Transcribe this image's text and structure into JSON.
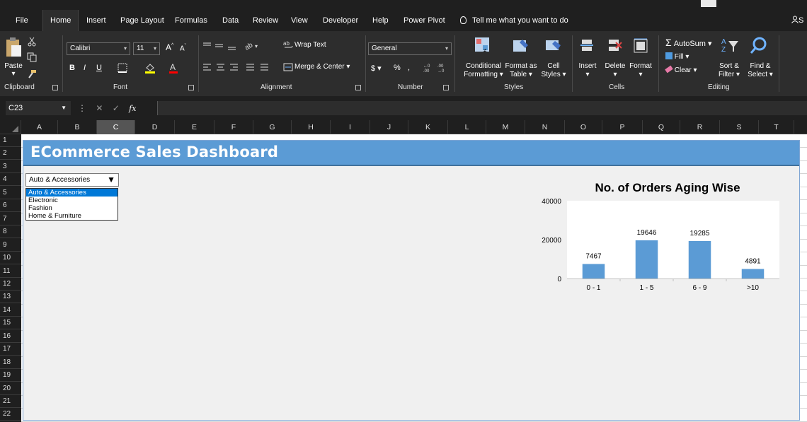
{
  "menu": {
    "tabs": [
      {
        "label": "File"
      },
      {
        "label": "Home",
        "active": true
      },
      {
        "label": "Insert"
      },
      {
        "label": "Page Layout"
      },
      {
        "label": "Formulas"
      },
      {
        "label": "Data"
      },
      {
        "label": "Review"
      },
      {
        "label": "View"
      },
      {
        "label": "Developer"
      },
      {
        "label": "Help"
      },
      {
        "label": "Power Pivot"
      }
    ],
    "tell_me": "Tell me what you want to do",
    "share": "S"
  },
  "ribbon": {
    "clipboard": {
      "paste": "Paste",
      "group": "Clipboard"
    },
    "font": {
      "name": "Calibri",
      "size": "11",
      "group": "Font",
      "bold": "B",
      "italic": "I",
      "underline": "U"
    },
    "alignment": {
      "wrap_text": "Wrap Text",
      "merge_center": "Merge & Center",
      "group": "Alignment"
    },
    "number": {
      "format": "General",
      "currency": "$",
      "percent": "%",
      "comma": ",",
      "group": "Number"
    },
    "styles": {
      "conditional_formatting": "Conditional Formatting",
      "conditional_line1": "Conditional",
      "conditional_line2": "Formatting",
      "format_as_table_line1": "Format as",
      "format_as_table_line2": "Table",
      "cell_styles_line1": "Cell",
      "cell_styles_line2": "Styles",
      "group": "Styles"
    },
    "cells": {
      "insert": "Insert",
      "delete": "Delete",
      "format": "Format",
      "group": "Cells"
    },
    "editing": {
      "autosum": "AutoSum",
      "fill": "Fill",
      "clear": "Clear",
      "sort_filter_line1": "Sort &",
      "sort_filter_line2": "Filter",
      "find_select_line1": "Find &",
      "find_select_line2": "Select",
      "group": "Editing"
    }
  },
  "formula_bar": {
    "name_box": "C23",
    "fx": "fx",
    "content": ""
  },
  "columns": [
    "A",
    "B",
    "C",
    "D",
    "E",
    "F",
    "G",
    "H",
    "I",
    "J",
    "K",
    "L",
    "M",
    "N",
    "O",
    "P",
    "Q",
    "R",
    "S",
    "T"
  ],
  "selected_column": "C",
  "rows": [
    "1",
    "2",
    "3",
    "4",
    "5",
    "6",
    "7",
    "8",
    "9",
    "10",
    "11",
    "12",
    "13",
    "14",
    "15",
    "16",
    "17",
    "18",
    "19",
    "20",
    "21",
    "22"
  ],
  "dashboard": {
    "title": "ECommerce Sales Dashboard",
    "category_dropdown": {
      "selected": "Auto & Accessories",
      "options": [
        "Auto & Accessories",
        "Electronic",
        "Fashion",
        "Home & Furniture"
      ]
    }
  },
  "chart_data": {
    "type": "bar",
    "title": "No. of Orders Aging Wise",
    "categories": [
      "0 - 1",
      "1 - 5",
      "6 - 9",
      ">10"
    ],
    "values": [
      7467,
      19646,
      19285,
      4891
    ],
    "ylim": [
      0,
      40000
    ],
    "yticks": [
      0,
      20000,
      40000
    ],
    "bar_color": "#5b9bd5",
    "data_labels": true,
    "legend": "none",
    "grid": false
  },
  "colors": {
    "ribbon_bg": "#2d2d2d",
    "menu_bg": "#1f1f1f",
    "dashboard_title_bg": "#5b9bd5",
    "dashboard_bg": "#f0f0f0"
  }
}
